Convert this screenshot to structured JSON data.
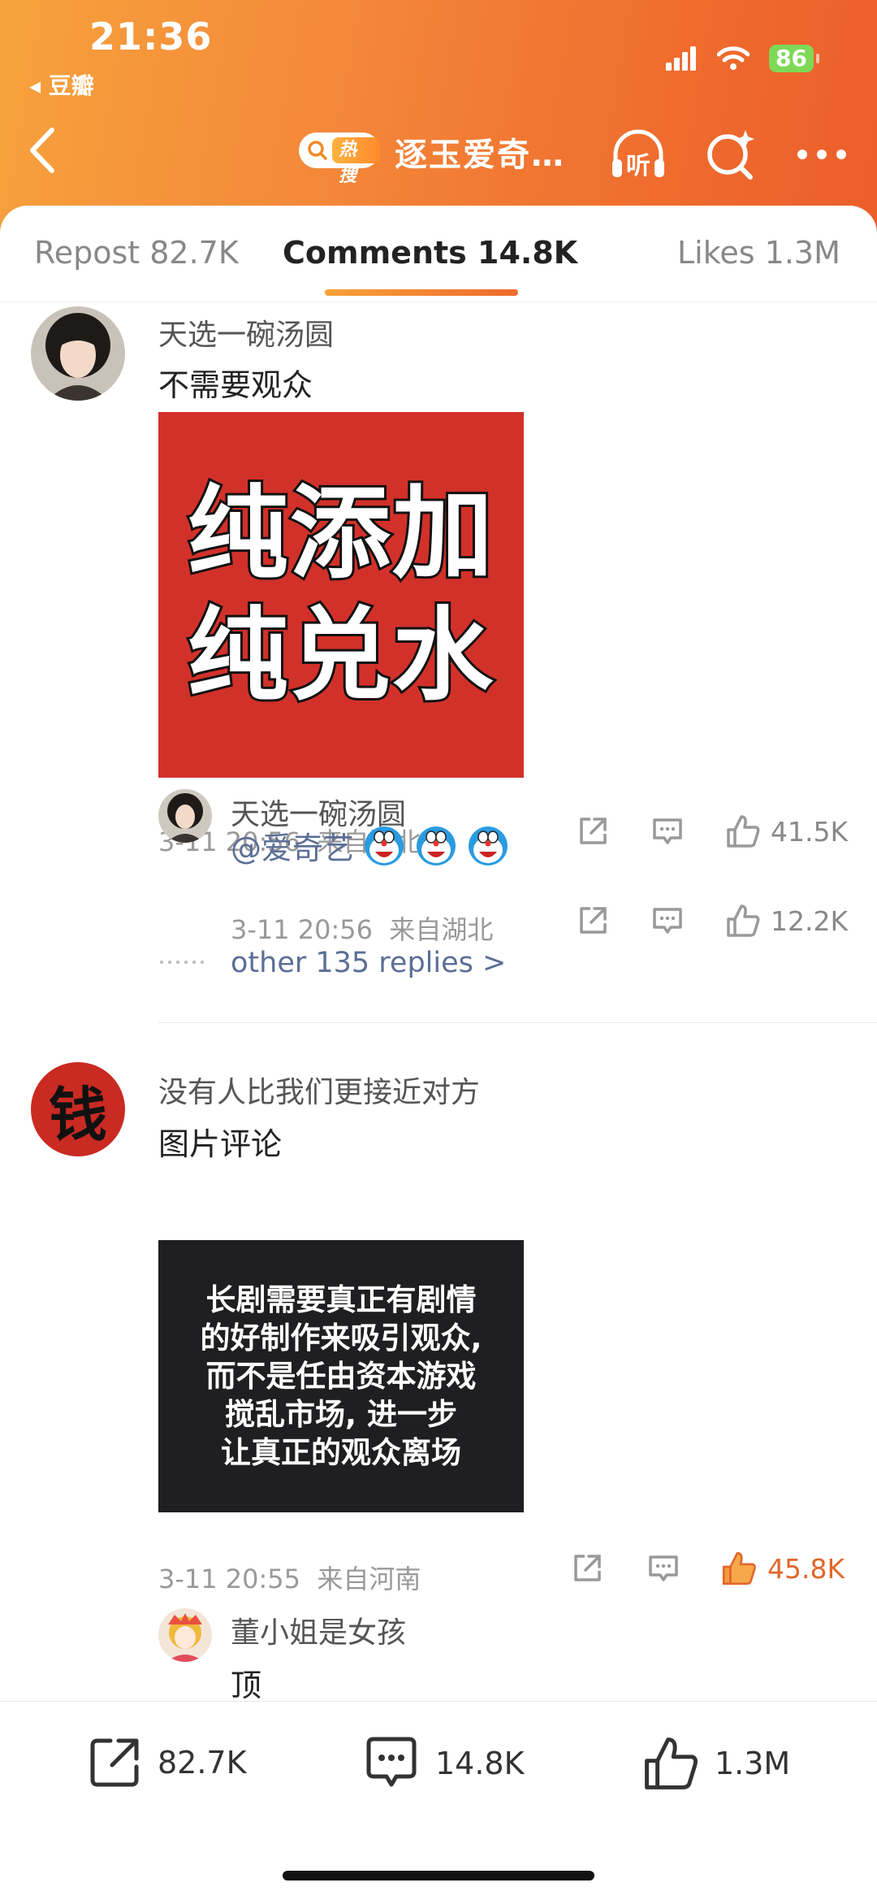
{
  "status_bar": {
    "time": "21:36",
    "back_app": "◂ 豆瓣",
    "battery": "86"
  },
  "header": {
    "hot_badge": "热搜",
    "title": "逐玉爱奇…",
    "listen_label": "听"
  },
  "tabs": [
    {
      "label": "Repost 82.7K"
    },
    {
      "label": "Comments 14.8K"
    },
    {
      "label": "Likes 1.3M"
    }
  ],
  "comments": [
    {
      "username": "天选一碗汤圆",
      "text": "不需要观众",
      "image_lines": [
        "纯添加",
        "纯兑水"
      ],
      "time": "3-11 20:56",
      "location": "来自湖北",
      "likes": "41.5K",
      "reply": {
        "username": "天选一碗汤圆",
        "text": "@爱奇艺",
        "time": "3-11 20:56",
        "location": "来自湖北",
        "likes": "12.2K"
      },
      "more_replies": "other 135 replies >"
    },
    {
      "username": "没有人比我们更接近对方",
      "avatar_char": "钱",
      "text": "图片评论",
      "image_lines": [
        "长剧需要真正有剧情",
        "的好制作来吸引观众,",
        "而不是任由资本游戏",
        "搅乱市场, 进一步",
        "让真正的观众离场"
      ],
      "time": "3-11 20:55",
      "location": "来自河南",
      "likes": "45.8K",
      "reply": {
        "username": "董小姐是女孩",
        "text": "顶"
      }
    }
  ],
  "bottom_bar": {
    "repost": "82.7K",
    "comments": "14.8K",
    "likes": "1.3M"
  },
  "colors": {
    "accent": "#ef6c2e",
    "liked": "#f08a3a"
  }
}
